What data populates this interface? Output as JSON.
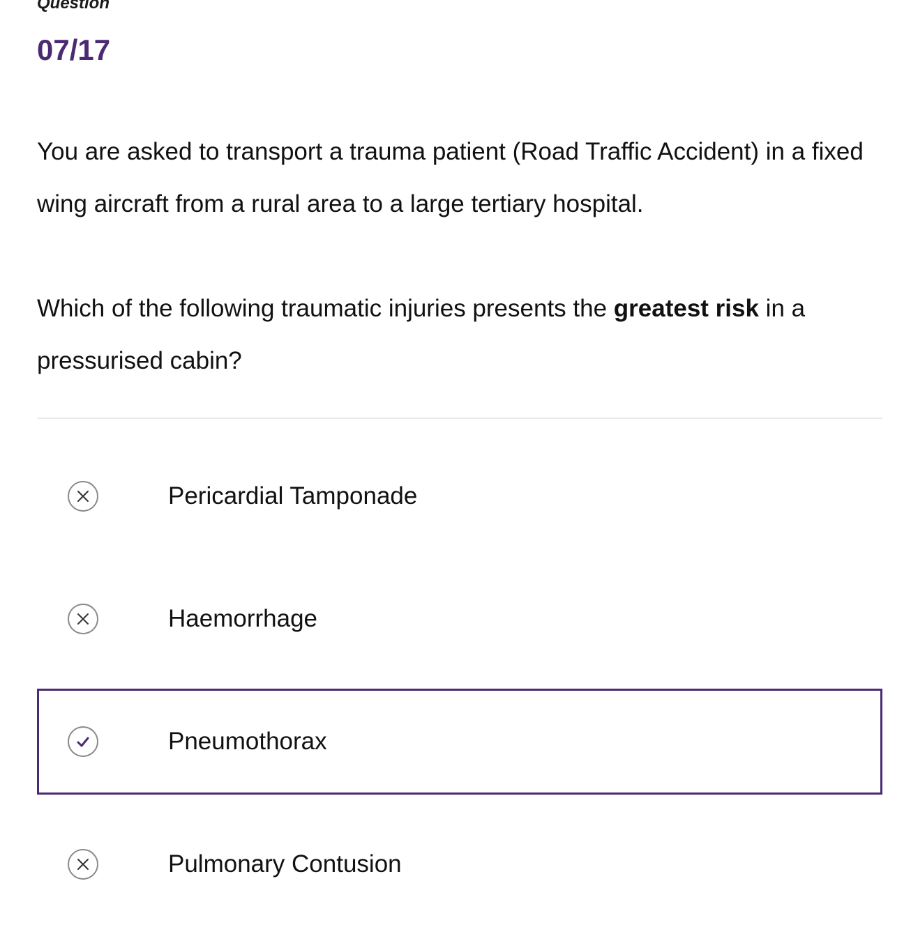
{
  "question": {
    "label": "Question",
    "number": "07/17",
    "scenario": "You are asked to transport a trauma patient (Road Traffic Accident) in a fixed wing aircraft from a rural area to a large tertiary hospital.",
    "prompt_before": "Which of the following traumatic injuries presents the ",
    "prompt_emphasis": "greatest risk",
    "prompt_after": " in a pressurised cabin?"
  },
  "answers": [
    {
      "label": "Pericardial Tamponade",
      "icon": "close-circle-icon",
      "status": "incorrect"
    },
    {
      "label": "Haemorrhage",
      "icon": "close-circle-icon",
      "status": "incorrect"
    },
    {
      "label": "Pneumothorax",
      "icon": "check-circle-icon",
      "status": "correct"
    },
    {
      "label": "Pulmonary Contusion",
      "icon": "close-circle-icon",
      "status": "incorrect"
    }
  ],
  "colors": {
    "accent": "#4a2a73",
    "icon_border": "#8a8a8a",
    "divider": "#ebebeb",
    "text": "#111111"
  }
}
